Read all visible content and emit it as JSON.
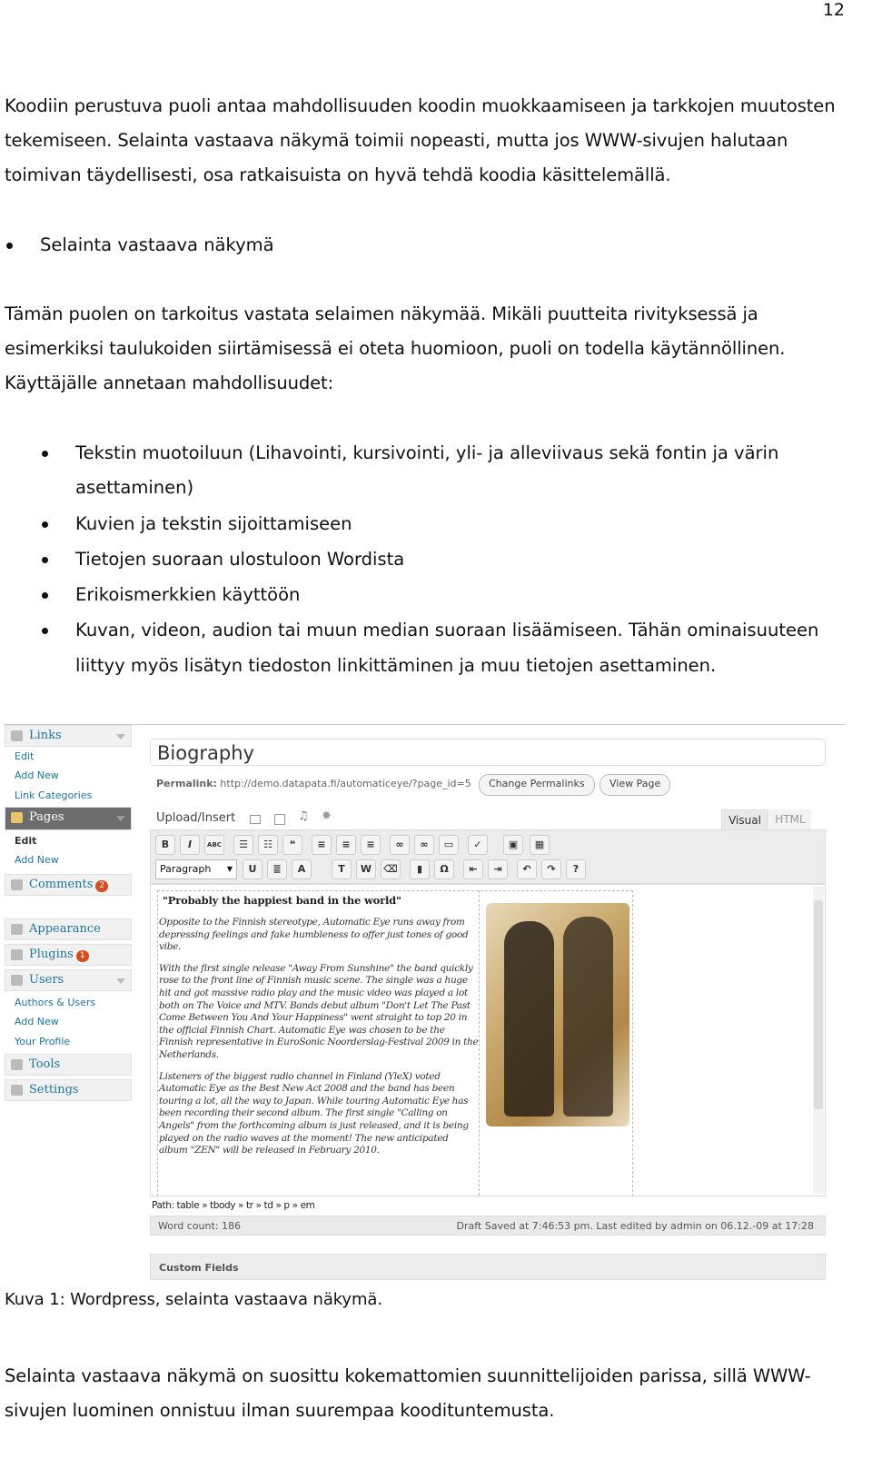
{
  "page_number": "12",
  "paragraphs": {
    "intro": [
      "Koodiin perustuva puoli antaa mahdollisuuden koodin muokkaamiseen ja tarkkojen muutosten",
      "tekemiseen. Selainta vastaava näkymä toimii nopeasti, mutta jos WWW-sivujen halutaan",
      "toimivan täydellisesti, osa ratkaisuista on hyvä tehdä koodia käsittelemällä."
    ],
    "heading_bullet": "Selainta vastaava näkymä",
    "section": [
      "Tämän puolen on tarkoitus vastata selaimen näkymää. Mikäli puutteita rivityksessä ja",
      "esimerkiksi taulukoiden siirtämisessä ei oteta huomioon, puoli on todella käytännöllinen.",
      "Käyttäjälle annetaan mahdollisuudet:"
    ],
    "bullets": [
      [
        "Tekstin muotoiluun (Lihavointi, kursivointi, yli- ja alleviivaus sekä fontin ja värin",
        "asettaminen)"
      ],
      [
        "Kuvien ja tekstin sijoittamiseen"
      ],
      [
        "Tietojen suoraan ulostuloon Wordista"
      ],
      [
        "Erikoismerkkien käyttöön"
      ],
      [
        "Kuvan, videon, audion tai muun median suoraan lisäämiseen. Tähän ominaisuuteen",
        "liittyy myös lisätyn tiedoston linkittäminen ja muu tietojen asettaminen."
      ]
    ],
    "caption": "Kuva 1: Wordpress, selainta vastaava näkymä.",
    "closing": [
      "Selainta vastaava näkymä on suosittu kokemattomien suunnittelijoiden parissa, sillä WWW-",
      "sivujen luominen onnistuu ilman suurempaa kooditunte­musta."
    ]
  },
  "screenshot": {
    "sidebar": {
      "links": {
        "label": "Links",
        "items": [
          "Edit",
          "Add New",
          "Link Categories"
        ]
      },
      "pages": {
        "label": "Pages",
        "items": [
          "Edit",
          "Add New"
        ]
      },
      "comments": {
        "label": "Comments",
        "badge": "2"
      },
      "appearance": "Appearance",
      "plugins": {
        "label": "Plugins",
        "badge": "1"
      },
      "users": {
        "label": "Users",
        "items": [
          "Authors & Users",
          "Add New",
          "Your Profile"
        ]
      },
      "tools": "Tools",
      "settings": "Settings"
    },
    "title_value": "Biography",
    "permalink_label": "Permalink:",
    "permalink_url": "http://demo.datapata.fi/automaticeye/?page_id=5",
    "change_permalinks": "Change Permalinks",
    "view_page": "View Page",
    "upload_insert": "Upload/Insert",
    "tabs": [
      "Visual",
      "HTML"
    ],
    "format_select": "Paragraph",
    "editor": {
      "heading": "\"Probably the happiest band in the world\"",
      "paragraphs": [
        "Opposite to the Finnish stereotype, Automatic Eye runs away from depressing feelings and fake humbleness to offer just tones of good vibe.",
        "With the first single release \"Away From Sunshine\" the band quickly rose to the front line of Finnish music scene. The single was a huge hit and got massive radio play and the music video was played a lot both on The Voice and MTV. Bands debut album \"Don't Let The Past Come Between You And Your Happiness\" went straight to top 20 in the official Finnish Chart. Automatic Eye was chosen to be the Finnish representative in EuroSonic Noorderslag-Festival 2009 in the Netherlands.",
        "Listeners of the biggest radio channel in Finland (YleX) voted Automatic Eye as the Best New Act 2008 and the band has been touring a lot, all the way to Japan. While touring Automatic Eye has been recording their second album. The first single \"Calling on Angels\" from the forthcoming album is just released, and it is being played on the radio waves at the moment! The new anticipated album \"ZEN\" will be released in February 2010."
      ]
    },
    "path": "Path: table » tbody » tr » td » p » em",
    "word_count": "Word count: 186",
    "draft_status": "Draft Saved at 7:46:53 pm. Last edited by admin on 06.12.-09 at 17:28",
    "custom_fields": "Custom Fields",
    "colors": {
      "link": "#21759b",
      "active_menu": "#6d6d6d",
      "badge": "#d54e21"
    }
  }
}
